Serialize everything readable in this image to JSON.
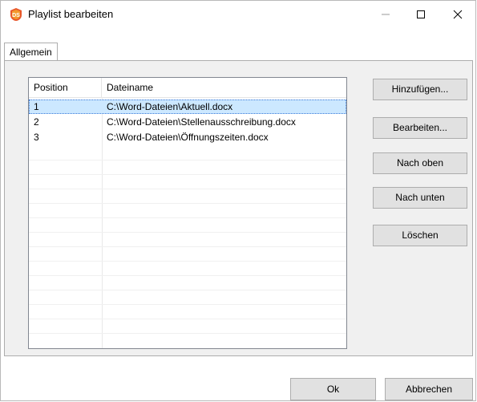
{
  "window": {
    "title": "Playlist bearbeiten",
    "icon": "ds-app-icon",
    "controls": {
      "minimize": "—",
      "maximize": "☐",
      "close": "✕"
    }
  },
  "tabs": [
    {
      "label": "Allgemein",
      "active": true
    }
  ],
  "list": {
    "columns": [
      "Position",
      "Dateiname"
    ],
    "rows": [
      {
        "position": "1",
        "filename": "C:\\Word-Dateien\\Aktuell.docx",
        "selected": true
      },
      {
        "position": "2",
        "filename": "C:\\Word-Dateien\\Stellenausschreibung.docx",
        "selected": false
      },
      {
        "position": "3",
        "filename": "C:\\Word-Dateien\\Öffnungszeiten.docx",
        "selected": false
      }
    ]
  },
  "buttons": {
    "add": "Hinzufügen...",
    "edit": "Bearbeiten...",
    "up": "Nach oben",
    "down": "Nach unten",
    "delete": "Löschen",
    "ok": "Ok",
    "cancel": "Abbrechen"
  },
  "colors": {
    "accent": "#e8572b",
    "selection": "#cce8ff",
    "panel": "#f0f0f0"
  }
}
